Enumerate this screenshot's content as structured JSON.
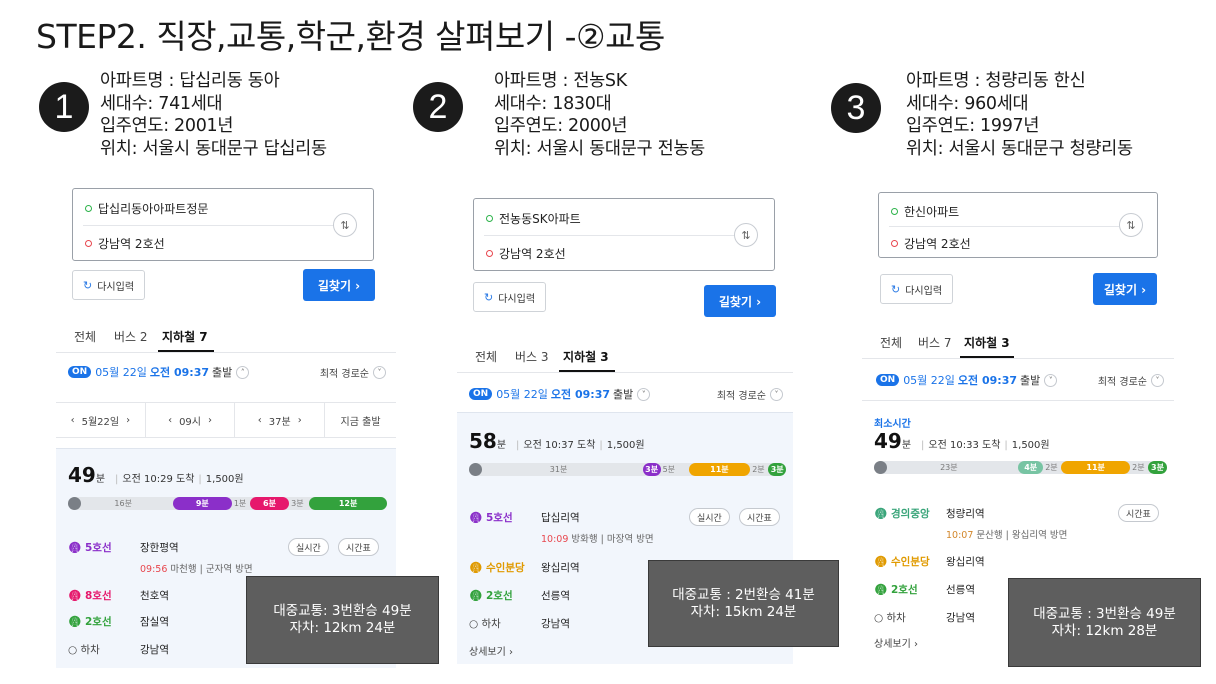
{
  "title": "STEP2. 직장,교통,학군,환경 살펴보기 -②교통",
  "colors": {
    "line5": "#8b2fc9",
    "line8": "#e6186c",
    "line2": "#33a23d",
    "bundang": "#f0a500",
    "gyeongui": "#77c4a3",
    "accent": "#1a73e8"
  },
  "apartments": [
    {
      "number": "1",
      "name": "아파트명 : 답십리동 동아",
      "households": "세대수: 741세대",
      "year": "입주연도: 2001년",
      "location": "위치: 서울시 동대문구 답십리동",
      "origin": "답십리동아아파트정문",
      "destination": "강남역 2호선",
      "reset": "다시입력",
      "find": "길찾기 ›",
      "swap_icon": "⇅",
      "tabs": [
        "전체",
        "버스 2",
        "지하철 7"
      ],
      "depart_on": "ON",
      "depart_date": "05월 22일",
      "depart_time": "오전 09:37",
      "depart_suffix": "출발",
      "sort": "최적 경로순",
      "time_selector": [
        "5월22일",
        "09시",
        "37분",
        "지금 출발"
      ],
      "fastest": "",
      "total_min": "49",
      "min_unit": "분",
      "arrival": "오전 10:29 도착",
      "fare": "1,500원",
      "segments": [
        {
          "label": "16분",
          "kind": "walk",
          "value": 16
        },
        {
          "label": "9분",
          "kind": "line5",
          "value": 9
        },
        {
          "label": "1분",
          "kind": "transfer",
          "value": 1
        },
        {
          "label": "6분",
          "kind": "line8",
          "value": 6
        },
        {
          "label": "3분",
          "kind": "transfer",
          "value": 3
        },
        {
          "label": "12분",
          "kind": "line2",
          "value": 12
        }
      ],
      "steps": [
        {
          "line": "5호선",
          "station": "장한평역",
          "sub_time": "09:56",
          "sub_dir": "마천행 | 군자역 방면",
          "color": "line5"
        },
        {
          "line": "8호선",
          "station": "천호역",
          "color": "line8"
        },
        {
          "line": "2호선",
          "station": "잠실역",
          "color": "line2"
        },
        {
          "line": "하차",
          "station": "강남역",
          "color": "alight"
        }
      ],
      "realtime": "실시간",
      "timetable": "시간표",
      "more": "",
      "overlay_transit": "대중교통: 3번환승 49분",
      "overlay_car": "자차: 12km 24분"
    },
    {
      "number": "2",
      "name": "아파트명 : 전농SK",
      "households": "세대수: 1830대",
      "year": "입주연도: 2000년",
      "location": "위치: 서울시 동대문구 전농동",
      "origin": "전농동SK아파트",
      "destination": "강남역 2호선",
      "reset": "다시입력",
      "find": "길찾기 ›",
      "swap_icon": "⇅",
      "tabs": [
        "전체",
        "버스 3",
        "지하철 3"
      ],
      "depart_on": "ON",
      "depart_date": "05월 22일",
      "depart_time": "오전 09:37",
      "depart_suffix": "출발",
      "sort": "최적 경로순",
      "fastest": "",
      "total_min": "58",
      "min_unit": "분",
      "arrival": "오전 10:37 도착",
      "fare": "1,500원",
      "segments": [
        {
          "label": "31분",
          "kind": "walk",
          "value": 31
        },
        {
          "label": "3분",
          "kind": "line5",
          "value": 3
        },
        {
          "label": "5분",
          "kind": "transfer",
          "value": 5
        },
        {
          "label": "11분",
          "kind": "bundang",
          "value": 11
        },
        {
          "label": "2분",
          "kind": "transfer",
          "value": 2
        },
        {
          "label": "3분",
          "kind": "line2",
          "value": 3
        }
      ],
      "steps": [
        {
          "line": "5호선",
          "station": "답십리역",
          "sub_time": "10:09",
          "sub_dir": "방화행 | 마장역 방면",
          "color": "line5"
        },
        {
          "line": "수인분당",
          "station": "왕십리역",
          "color": "bundang"
        },
        {
          "line": "2호선",
          "station": "선릉역",
          "color": "line2"
        },
        {
          "line": "하차",
          "station": "강남역",
          "color": "alight"
        }
      ],
      "realtime": "실시간",
      "timetable": "시간표",
      "more": "상세보기 ›",
      "overlay_transit": "대중교통 : 2번환승 41분",
      "overlay_car": "자차: 15km 24분"
    },
    {
      "number": "3",
      "name": "아파트명 : 청량리동 한신",
      "households": "세대수: 960세대",
      "year": "입주연도: 1997년",
      "location": "위치: 서울시 동대문구 청량리동",
      "origin": "한신아파트",
      "destination": "강남역 2호선",
      "reset": "다시입력",
      "find": "길찾기 ›",
      "swap_icon": "⇅",
      "tabs": [
        "전체",
        "버스 7",
        "지하철 3"
      ],
      "depart_on": "ON",
      "depart_date": "05월 22일",
      "depart_time": "오전 09:37",
      "depart_suffix": "출발",
      "sort": "최적 경로순",
      "fastest": "최소시간",
      "total_min": "49",
      "min_unit": "분",
      "arrival": "오전 10:33 도착",
      "fare": "1,500원",
      "segments": [
        {
          "label": "23분",
          "kind": "walk",
          "value": 23
        },
        {
          "label": "4분",
          "kind": "gyeongui",
          "value": 4
        },
        {
          "label": "2분",
          "kind": "transfer",
          "value": 2
        },
        {
          "label": "11분",
          "kind": "bundang",
          "value": 11
        },
        {
          "label": "2분",
          "kind": "transfer",
          "value": 2
        },
        {
          "label": "3분",
          "kind": "line2",
          "value": 3
        }
      ],
      "steps": [
        {
          "line": "경의중앙",
          "station": "청량리역",
          "sub_time": "10:07",
          "sub_dir": "문산행 | 왕십리역 방면",
          "color": "gyeongui"
        },
        {
          "line": "수인분당",
          "station": "왕십리역",
          "color": "bundang"
        },
        {
          "line": "2호선",
          "station": "선릉역",
          "color": "line2"
        },
        {
          "line": "하차",
          "station": "강남역",
          "color": "alight"
        }
      ],
      "realtime": "",
      "timetable": "시간표",
      "more": "상세보기 ›",
      "overlay_transit": "대중교통 : 3번환승 49분",
      "overlay_car": "자차: 12km 28분"
    }
  ]
}
